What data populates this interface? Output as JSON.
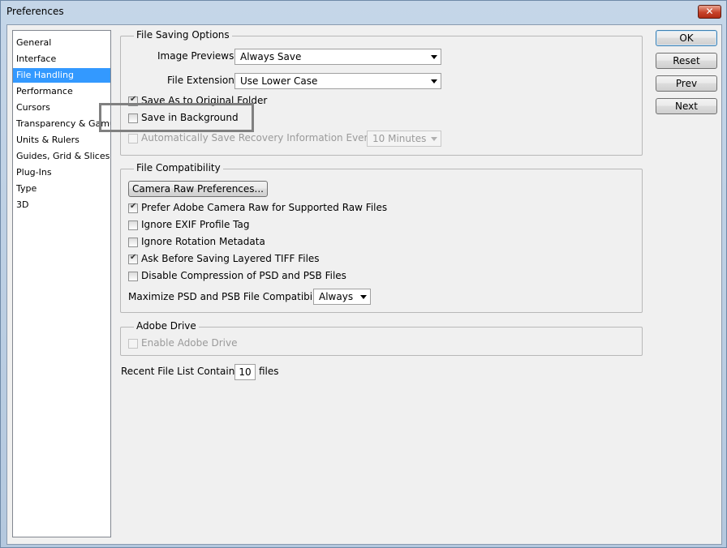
{
  "window": {
    "title": "Preferences",
    "close_glyph": "✕"
  },
  "sidebar": {
    "items": [
      {
        "label": "General",
        "selected": false
      },
      {
        "label": "Interface",
        "selected": false
      },
      {
        "label": "File Handling",
        "selected": true
      },
      {
        "label": "Performance",
        "selected": false
      },
      {
        "label": "Cursors",
        "selected": false
      },
      {
        "label": "Transparency & Gamut",
        "selected": false
      },
      {
        "label": "Units & Rulers",
        "selected": false
      },
      {
        "label": "Guides, Grid & Slices",
        "selected": false
      },
      {
        "label": "Plug-Ins",
        "selected": false
      },
      {
        "label": "Type",
        "selected": false
      },
      {
        "label": "3D",
        "selected": false
      }
    ]
  },
  "file_saving": {
    "legend": "File Saving Options",
    "image_previews_label": "Image Previews:",
    "image_previews_value": "Always Save",
    "file_extension_label": "File Extension:",
    "file_extension_value": "Use Lower Case",
    "save_as_original": {
      "label": "Save As to Original Folder",
      "checked": true
    },
    "save_in_background": {
      "label": "Save in Background",
      "checked": false
    },
    "auto_save": {
      "label": "Automatically Save Recovery Information Every:",
      "checked": false,
      "disabled": true
    },
    "auto_save_interval": "10 Minutes"
  },
  "file_compat": {
    "legend": "File Compatibility",
    "camera_raw_button": "Camera Raw Preferences...",
    "options": [
      {
        "label": "Prefer Adobe Camera Raw for Supported Raw Files",
        "checked": true
      },
      {
        "label": "Ignore EXIF Profile Tag",
        "checked": false
      },
      {
        "label": "Ignore Rotation Metadata",
        "checked": false
      },
      {
        "label": "Ask Before Saving Layered TIFF Files",
        "checked": true
      },
      {
        "label": "Disable Compression of PSD and PSB Files",
        "checked": false
      }
    ],
    "maximize_label": "Maximize PSD and PSB File Compatibility:",
    "maximize_value": "Always"
  },
  "adobe_drive": {
    "legend": "Adobe Drive",
    "enable": {
      "label": "Enable Adobe Drive",
      "checked": false,
      "disabled": true
    }
  },
  "recent": {
    "label": "Recent File List Contains:",
    "value": "10",
    "suffix": "files"
  },
  "buttons": {
    "ok": "OK",
    "reset": "Reset",
    "prev": "Prev",
    "next": "Next"
  }
}
